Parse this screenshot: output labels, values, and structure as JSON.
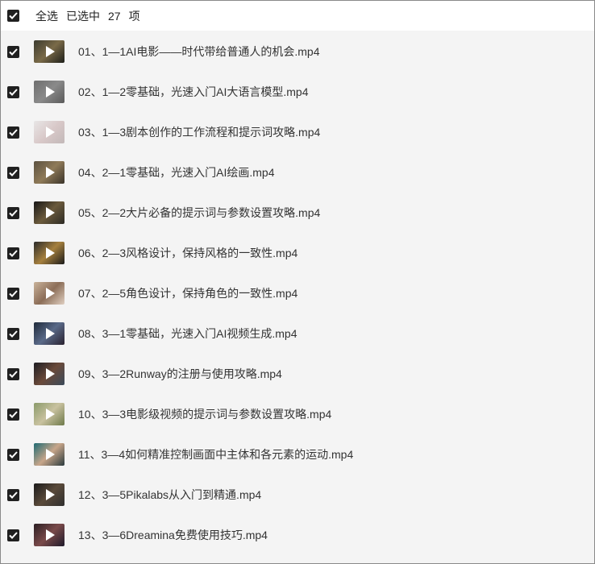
{
  "header": {
    "select_all_label": "全选",
    "selected_prefix": "已选中",
    "selected_count": "27",
    "selected_suffix": "项"
  },
  "files": [
    {
      "name": "01、1—1AI电影——时代带给普通人的机会.mp4",
      "thumb_colors": [
        "#3b3a2e",
        "#7a6a48",
        "#1d1f1a"
      ]
    },
    {
      "name": "02、1—2零基础，光速入门AI大语言模型.mp4",
      "thumb_colors": [
        "#6e6e6e",
        "#8a8a8a",
        "#5a5a5a"
      ]
    },
    {
      "name": "03、1—3剧本创作的工作流程和提示词攻略.mp4",
      "thumb_colors": [
        "#e8e6e6",
        "#d9c9c9",
        "#c2b8b8"
      ]
    },
    {
      "name": "04、2—1零基础，光速入门AI绘画.mp4",
      "thumb_colors": [
        "#5b5140",
        "#8f7a58",
        "#3a342a"
      ]
    },
    {
      "name": "05、2—2大片必备的提示词与参数设置攻略.mp4",
      "thumb_colors": [
        "#161616",
        "#6b5a3c",
        "#2c2a24"
      ]
    },
    {
      "name": "06、2—3风格设计，保持风格的一致性.mp4",
      "thumb_colors": [
        "#2a2a2a",
        "#a6803e",
        "#1a1a1a"
      ]
    },
    {
      "name": "07、2—5角色设计，保持角色的一致性.mp4",
      "thumb_colors": [
        "#c9b29a",
        "#8c6e58",
        "#e0d0c2"
      ]
    },
    {
      "name": "08、3—1零基础，光速入门AI视频生成.mp4",
      "thumb_colors": [
        "#1f2a3a",
        "#5a6a88",
        "#2a2230"
      ]
    },
    {
      "name": "09、3—2Runway的注册与使用攻略.mp4",
      "thumb_colors": [
        "#1c1c22",
        "#6a4a3a",
        "#3a4a5a"
      ]
    },
    {
      "name": "10、3—3电影级视频的提示词与参数设置攻略.mp4",
      "thumb_colors": [
        "#8a9a6a",
        "#c9c2a0",
        "#6e7a4a"
      ]
    },
    {
      "name": "11、3—4如何精准控制画面中主体和各元素的运动.mp4",
      "thumb_colors": [
        "#1e6a72",
        "#c8a68a",
        "#2a3a3e"
      ]
    },
    {
      "name": "12、3—5Pikalabs从入门到精通.mp4",
      "thumb_colors": [
        "#1a1a1a",
        "#5a4a3a",
        "#2e2e2e"
      ]
    },
    {
      "name": "13、3—6Dreamina免费使用技巧.mp4",
      "thumb_colors": [
        "#2a1e22",
        "#7a4a4a",
        "#1e1a2a"
      ]
    }
  ],
  "colors": {
    "checkbox": "#202020",
    "list_bg": "#f4f4f4",
    "header_bg": "#ffffff",
    "border": "#8a8a8a"
  },
  "icons": {
    "checkbox": "checkmark-icon",
    "play": "play-icon"
  }
}
